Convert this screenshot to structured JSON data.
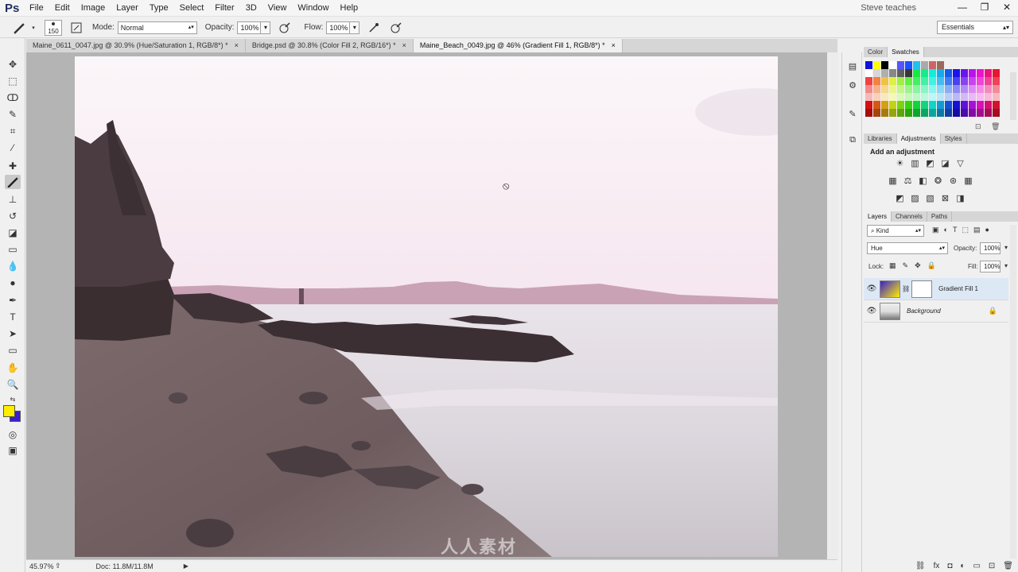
{
  "app": {
    "logo": "Ps",
    "user": "Steve teaches",
    "menu": [
      "File",
      "Edit",
      "Image",
      "Layer",
      "Type",
      "Select",
      "Filter",
      "3D",
      "View",
      "Window",
      "Help"
    ],
    "window_buttons": [
      "—",
      "❐",
      "✕"
    ]
  },
  "options": {
    "brush_size": "150",
    "mode_label": "Mode:",
    "mode_value": "Normal",
    "opacity_label": "Opacity:",
    "opacity_value": "100%",
    "flow_label": "Flow:",
    "flow_value": "100%",
    "workspace": "Essentials"
  },
  "tabs": [
    {
      "label": "Maine_0611_0047.jpg @ 30.9% (Hue/Saturation 1, RGB/8*) *",
      "active": false
    },
    {
      "label": "Bridge.psd @ 30.8% (Color Fill 2, RGB/16*) *",
      "active": false
    },
    {
      "label": "Maine_Beach_0049.jpg @ 46% (Gradient Fill 1, RGB/8*) *",
      "active": true
    }
  ],
  "status": {
    "zoom": "45.97%",
    "doc": "Doc: 11.8M/11.8M"
  },
  "tools": [
    "move-tool-icon",
    "marquee-tool-icon",
    "lasso-tool-icon",
    "quick-select-tool-icon",
    "crop-tool-icon",
    "eyedropper-tool-icon",
    "healing-tool-icon",
    "brush-tool-icon",
    "clone-stamp-tool-icon",
    "history-brush-tool-icon",
    "eraser-tool-icon",
    "gradient-tool-icon",
    "blur-tool-icon",
    "dodge-tool-icon",
    "pen-tool-icon",
    "type-tool-icon",
    "path-select-tool-icon",
    "shape-tool-icon",
    "hand-tool-icon",
    "zoom-tool-icon"
  ],
  "colors": {
    "foreground": "#ffee00",
    "background": "#3a1fd0"
  },
  "panels": {
    "color_tabs": [
      "Color",
      "Swatches"
    ],
    "adj_tabs": [
      "Libraries",
      "Adjustments",
      "Styles"
    ],
    "adj_title": "Add an adjustment",
    "layer_tabs": [
      "Layers",
      "Channels",
      "Paths"
    ],
    "kind_label": "Kind",
    "blend_mode": "Hue",
    "opacity_label": "Opacity:",
    "opacity_value": "100%",
    "lock_label": "Lock:",
    "fill_label": "Fill:",
    "fill_value": "100%",
    "layers": [
      {
        "name": "Gradient Fill 1",
        "selected": true
      },
      {
        "name": "Background",
        "selected": false
      }
    ]
  },
  "watermark": "人人素材"
}
